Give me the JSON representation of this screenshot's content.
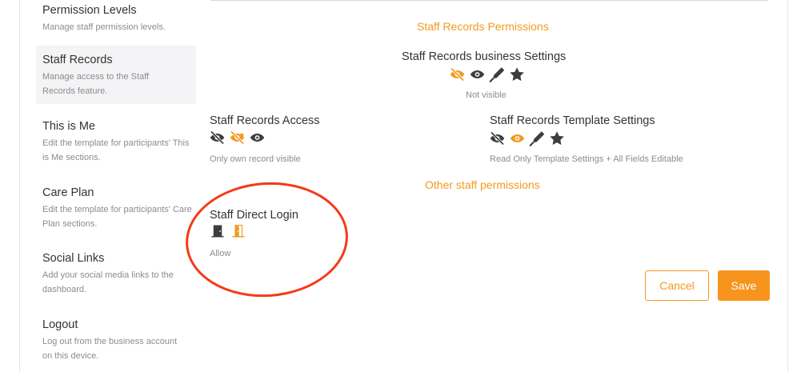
{
  "sidebar": {
    "items": [
      {
        "title": "Permission Levels",
        "desc": "Manage staff permission levels."
      },
      {
        "title": "Staff Records",
        "desc": "Manage access to the Staff Records feature."
      },
      {
        "title": "This is Me",
        "desc": "Edit the template for participants' This is Me sections."
      },
      {
        "title": "Care Plan",
        "desc": "Edit the template for participants' Care Plan sections."
      },
      {
        "title": "Social Links",
        "desc": "Add your social media links to the dashboard."
      },
      {
        "title": "Logout",
        "desc": "Log out from the business account on this device."
      }
    ],
    "active_index": 1
  },
  "main": {
    "section_staff_records": "Staff Records Permissions",
    "business_settings": {
      "title": "Staff Records business Settings",
      "status": "Not visible",
      "icons": [
        "eye-slash-icon",
        "eye-icon",
        "pen-icon",
        "star-icon"
      ],
      "selected": "eye-slash-icon"
    },
    "records_access": {
      "title": "Staff Records Access",
      "status": "Only own record visible",
      "icons": [
        "eye-slash-icon",
        "eye-slash-icon",
        "eye-icon"
      ],
      "selected_index": 1
    },
    "template_settings": {
      "title": "Staff Records Template Settings",
      "status": "Read Only Template Settings + All Fields Editable",
      "icons": [
        "eye-slash-icon",
        "eye-icon",
        "pen-icon",
        "star-icon"
      ],
      "selected": "eye-icon"
    },
    "section_other": "Other staff permissions",
    "direct_login": {
      "title": "Staff Direct Login",
      "status": "Allow",
      "icons": [
        "door-closed-icon",
        "door-open-icon"
      ],
      "selected": "door-open-icon"
    }
  },
  "actions": {
    "cancel_label": "Cancel",
    "save_label": "Save"
  },
  "colors": {
    "accent": "#f29a1f",
    "icon_default": "#3d3d3d",
    "annotation": "#f43a1a"
  }
}
